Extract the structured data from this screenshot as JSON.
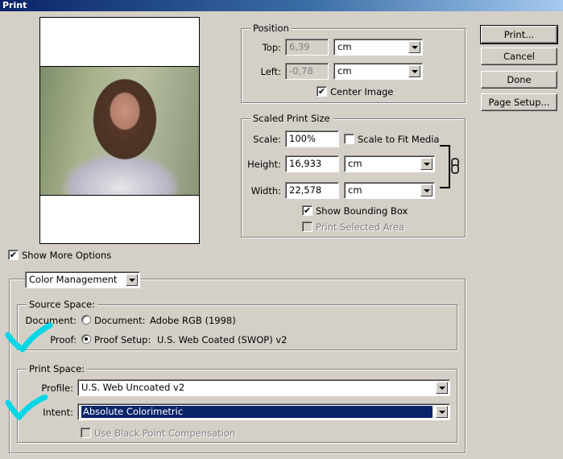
{
  "window": {
    "title": "Print"
  },
  "buttons": {
    "print": "Print...",
    "cancel": "Cancel",
    "done": "Done",
    "page_setup": "Page Setup..."
  },
  "position": {
    "legend": "Position",
    "top_label": "Top:",
    "top_value": "6,39",
    "top_unit": "cm",
    "left_label": "Left:",
    "left_value": "-0,78",
    "left_unit": "cm",
    "center_image_label": "Center Image",
    "center_image_checked": true
  },
  "scaled": {
    "legend": "Scaled Print Size",
    "scale_label": "Scale:",
    "scale_value": "100%",
    "scale_to_fit_label": "Scale to Fit Media",
    "scale_to_fit_checked": false,
    "height_label": "Height:",
    "height_value": "16,933",
    "height_unit": "cm",
    "width_label": "Width:",
    "width_value": "22,578",
    "width_unit": "cm",
    "show_bbox_label": "Show Bounding Box",
    "show_bbox_checked": true,
    "print_selected_label": "Print Selected Area",
    "print_selected_checked": false
  },
  "show_more": {
    "label": "Show More Options",
    "checked": true
  },
  "color_mgmt": {
    "selector_value": "Color Management",
    "source_legend": "Source Space:",
    "document_label": "Document:",
    "document_radio_label": "Document:",
    "document_profile": "Adobe RGB (1998)",
    "proof_label": "Proof:",
    "proof_radio_label": "Proof Setup:",
    "proof_profile": "U.S. Web Coated (SWOP) v2",
    "print_legend": "Print Space:",
    "profile_label": "Profile:",
    "profile_value": "U.S. Web Uncoated v2",
    "intent_label": "Intent:",
    "intent_value": "Absolute Colorimetric",
    "bpc_label": "Use Black Point Compensation",
    "bpc_checked": false
  },
  "colors": {
    "selection": "#0a246a",
    "checkmark_annotation": "#00d6e6",
    "title_bar": "#0a246a"
  },
  "icons": [
    "chain-link-icon",
    "checkmark-annotation-icon",
    "dropdown-arrow-icon"
  ]
}
